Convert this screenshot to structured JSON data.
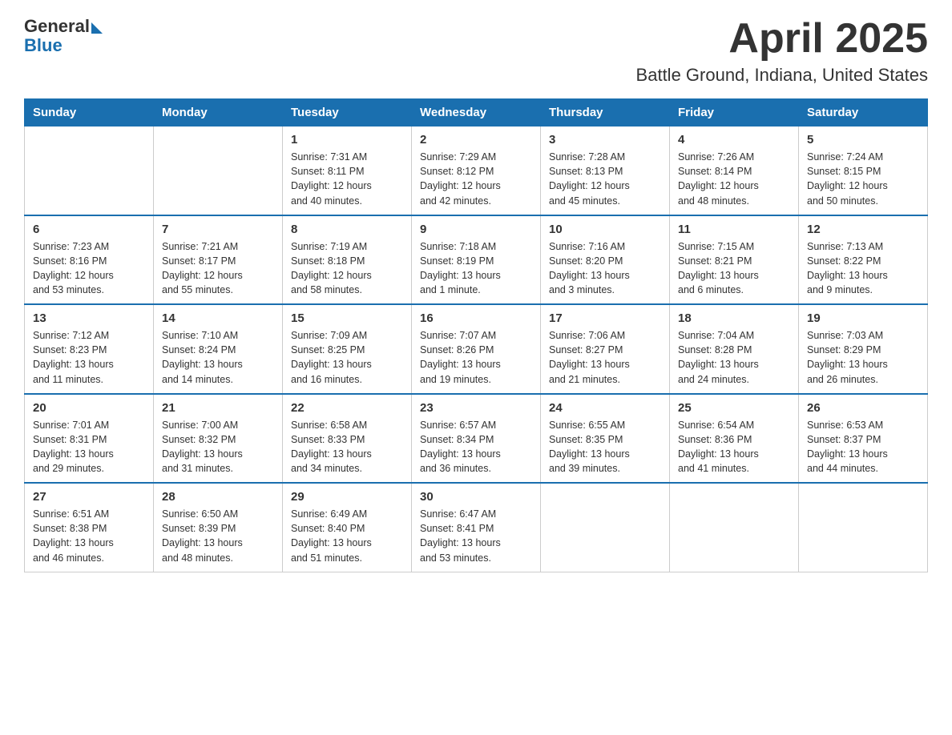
{
  "header": {
    "logo_general": "General",
    "logo_blue": "Blue",
    "title": "April 2025",
    "subtitle": "Battle Ground, Indiana, United States"
  },
  "calendar": {
    "days_of_week": [
      "Sunday",
      "Monday",
      "Tuesday",
      "Wednesday",
      "Thursday",
      "Friday",
      "Saturday"
    ],
    "weeks": [
      [
        {
          "day": "",
          "info": ""
        },
        {
          "day": "",
          "info": ""
        },
        {
          "day": "1",
          "info": "Sunrise: 7:31 AM\nSunset: 8:11 PM\nDaylight: 12 hours\nand 40 minutes."
        },
        {
          "day": "2",
          "info": "Sunrise: 7:29 AM\nSunset: 8:12 PM\nDaylight: 12 hours\nand 42 minutes."
        },
        {
          "day": "3",
          "info": "Sunrise: 7:28 AM\nSunset: 8:13 PM\nDaylight: 12 hours\nand 45 minutes."
        },
        {
          "day": "4",
          "info": "Sunrise: 7:26 AM\nSunset: 8:14 PM\nDaylight: 12 hours\nand 48 minutes."
        },
        {
          "day": "5",
          "info": "Sunrise: 7:24 AM\nSunset: 8:15 PM\nDaylight: 12 hours\nand 50 minutes."
        }
      ],
      [
        {
          "day": "6",
          "info": "Sunrise: 7:23 AM\nSunset: 8:16 PM\nDaylight: 12 hours\nand 53 minutes."
        },
        {
          "day": "7",
          "info": "Sunrise: 7:21 AM\nSunset: 8:17 PM\nDaylight: 12 hours\nand 55 minutes."
        },
        {
          "day": "8",
          "info": "Sunrise: 7:19 AM\nSunset: 8:18 PM\nDaylight: 12 hours\nand 58 minutes."
        },
        {
          "day": "9",
          "info": "Sunrise: 7:18 AM\nSunset: 8:19 PM\nDaylight: 13 hours\nand 1 minute."
        },
        {
          "day": "10",
          "info": "Sunrise: 7:16 AM\nSunset: 8:20 PM\nDaylight: 13 hours\nand 3 minutes."
        },
        {
          "day": "11",
          "info": "Sunrise: 7:15 AM\nSunset: 8:21 PM\nDaylight: 13 hours\nand 6 minutes."
        },
        {
          "day": "12",
          "info": "Sunrise: 7:13 AM\nSunset: 8:22 PM\nDaylight: 13 hours\nand 9 minutes."
        }
      ],
      [
        {
          "day": "13",
          "info": "Sunrise: 7:12 AM\nSunset: 8:23 PM\nDaylight: 13 hours\nand 11 minutes."
        },
        {
          "day": "14",
          "info": "Sunrise: 7:10 AM\nSunset: 8:24 PM\nDaylight: 13 hours\nand 14 minutes."
        },
        {
          "day": "15",
          "info": "Sunrise: 7:09 AM\nSunset: 8:25 PM\nDaylight: 13 hours\nand 16 minutes."
        },
        {
          "day": "16",
          "info": "Sunrise: 7:07 AM\nSunset: 8:26 PM\nDaylight: 13 hours\nand 19 minutes."
        },
        {
          "day": "17",
          "info": "Sunrise: 7:06 AM\nSunset: 8:27 PM\nDaylight: 13 hours\nand 21 minutes."
        },
        {
          "day": "18",
          "info": "Sunrise: 7:04 AM\nSunset: 8:28 PM\nDaylight: 13 hours\nand 24 minutes."
        },
        {
          "day": "19",
          "info": "Sunrise: 7:03 AM\nSunset: 8:29 PM\nDaylight: 13 hours\nand 26 minutes."
        }
      ],
      [
        {
          "day": "20",
          "info": "Sunrise: 7:01 AM\nSunset: 8:31 PM\nDaylight: 13 hours\nand 29 minutes."
        },
        {
          "day": "21",
          "info": "Sunrise: 7:00 AM\nSunset: 8:32 PM\nDaylight: 13 hours\nand 31 minutes."
        },
        {
          "day": "22",
          "info": "Sunrise: 6:58 AM\nSunset: 8:33 PM\nDaylight: 13 hours\nand 34 minutes."
        },
        {
          "day": "23",
          "info": "Sunrise: 6:57 AM\nSunset: 8:34 PM\nDaylight: 13 hours\nand 36 minutes."
        },
        {
          "day": "24",
          "info": "Sunrise: 6:55 AM\nSunset: 8:35 PM\nDaylight: 13 hours\nand 39 minutes."
        },
        {
          "day": "25",
          "info": "Sunrise: 6:54 AM\nSunset: 8:36 PM\nDaylight: 13 hours\nand 41 minutes."
        },
        {
          "day": "26",
          "info": "Sunrise: 6:53 AM\nSunset: 8:37 PM\nDaylight: 13 hours\nand 44 minutes."
        }
      ],
      [
        {
          "day": "27",
          "info": "Sunrise: 6:51 AM\nSunset: 8:38 PM\nDaylight: 13 hours\nand 46 minutes."
        },
        {
          "day": "28",
          "info": "Sunrise: 6:50 AM\nSunset: 8:39 PM\nDaylight: 13 hours\nand 48 minutes."
        },
        {
          "day": "29",
          "info": "Sunrise: 6:49 AM\nSunset: 8:40 PM\nDaylight: 13 hours\nand 51 minutes."
        },
        {
          "day": "30",
          "info": "Sunrise: 6:47 AM\nSunset: 8:41 PM\nDaylight: 13 hours\nand 53 minutes."
        },
        {
          "day": "",
          "info": ""
        },
        {
          "day": "",
          "info": ""
        },
        {
          "day": "",
          "info": ""
        }
      ]
    ]
  }
}
